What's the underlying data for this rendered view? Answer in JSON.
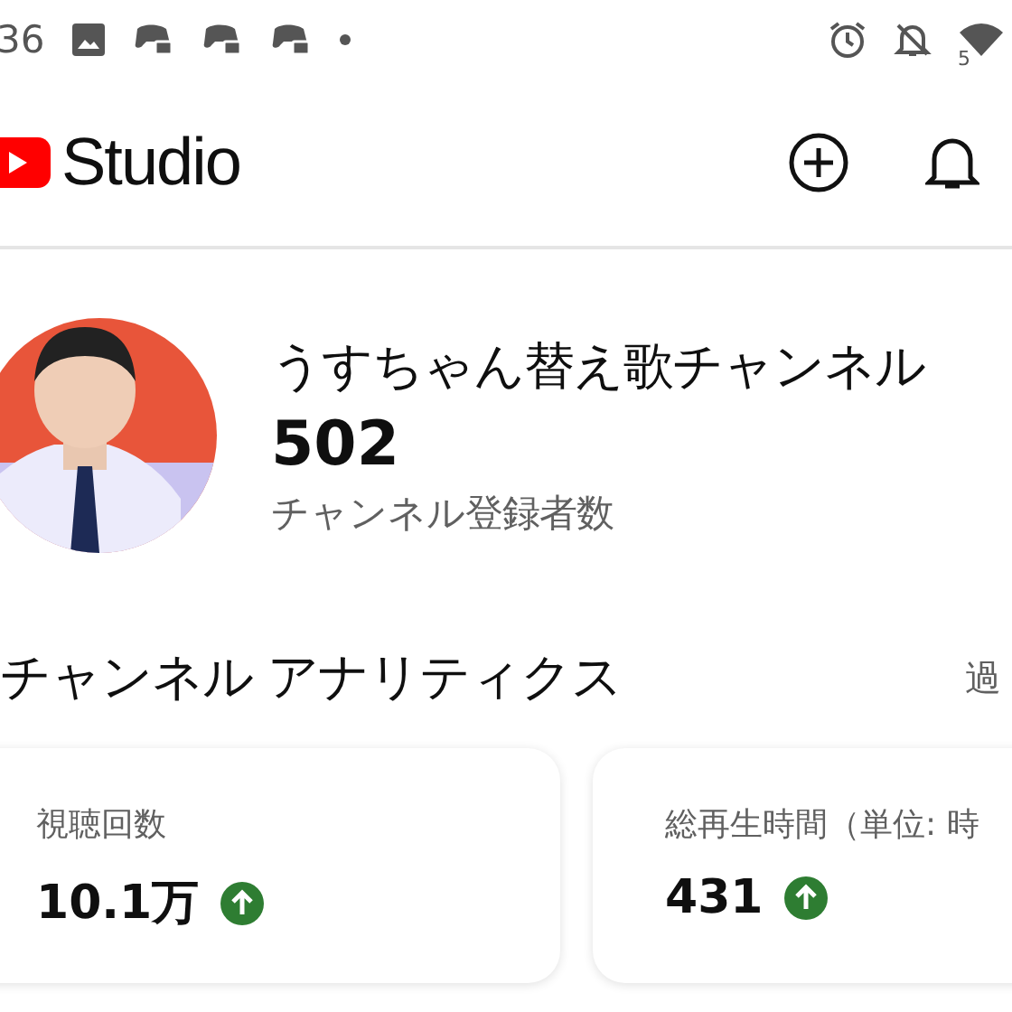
{
  "status_bar": {
    "time": "36",
    "wifi_badge": "5"
  },
  "header": {
    "logo_text": "Studio"
  },
  "channel": {
    "name": "うすちゃん替え歌チャンネル",
    "subscribers": "502",
    "subscribers_label": "チャンネル登録者数"
  },
  "analytics": {
    "title": "チャンネル アナリティクス",
    "period": "過",
    "cards": [
      {
        "label": "視聴回数",
        "value": "10.1万",
        "rising": true
      },
      {
        "label": "総再生時間（単位: 時",
        "value": "431",
        "rising": true
      }
    ]
  }
}
